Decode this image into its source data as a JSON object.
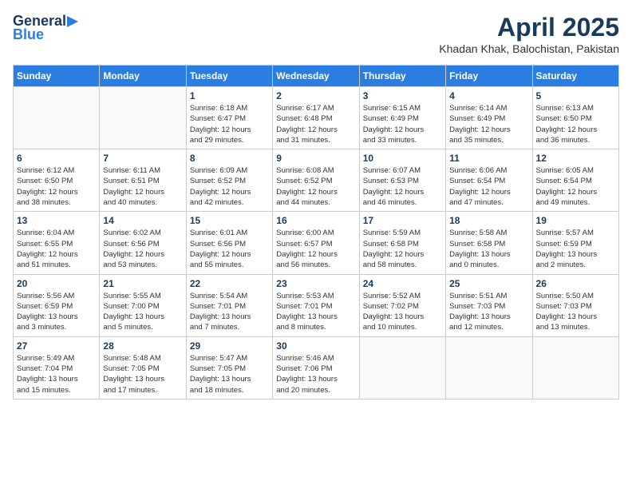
{
  "header": {
    "logo_general": "General",
    "logo_blue": "Blue",
    "title": "April 2025",
    "location": "Khadan Khak, Balochistan, Pakistan"
  },
  "weekdays": [
    "Sunday",
    "Monday",
    "Tuesday",
    "Wednesday",
    "Thursday",
    "Friday",
    "Saturday"
  ],
  "weeks": [
    [
      {
        "day": "",
        "info": ""
      },
      {
        "day": "",
        "info": ""
      },
      {
        "day": "1",
        "info": "Sunrise: 6:18 AM\nSunset: 6:47 PM\nDaylight: 12 hours\nand 29 minutes."
      },
      {
        "day": "2",
        "info": "Sunrise: 6:17 AM\nSunset: 6:48 PM\nDaylight: 12 hours\nand 31 minutes."
      },
      {
        "day": "3",
        "info": "Sunrise: 6:15 AM\nSunset: 6:49 PM\nDaylight: 12 hours\nand 33 minutes."
      },
      {
        "day": "4",
        "info": "Sunrise: 6:14 AM\nSunset: 6:49 PM\nDaylight: 12 hours\nand 35 minutes."
      },
      {
        "day": "5",
        "info": "Sunrise: 6:13 AM\nSunset: 6:50 PM\nDaylight: 12 hours\nand 36 minutes."
      }
    ],
    [
      {
        "day": "6",
        "info": "Sunrise: 6:12 AM\nSunset: 6:50 PM\nDaylight: 12 hours\nand 38 minutes."
      },
      {
        "day": "7",
        "info": "Sunrise: 6:11 AM\nSunset: 6:51 PM\nDaylight: 12 hours\nand 40 minutes."
      },
      {
        "day": "8",
        "info": "Sunrise: 6:09 AM\nSunset: 6:52 PM\nDaylight: 12 hours\nand 42 minutes."
      },
      {
        "day": "9",
        "info": "Sunrise: 6:08 AM\nSunset: 6:52 PM\nDaylight: 12 hours\nand 44 minutes."
      },
      {
        "day": "10",
        "info": "Sunrise: 6:07 AM\nSunset: 6:53 PM\nDaylight: 12 hours\nand 46 minutes."
      },
      {
        "day": "11",
        "info": "Sunrise: 6:06 AM\nSunset: 6:54 PM\nDaylight: 12 hours\nand 47 minutes."
      },
      {
        "day": "12",
        "info": "Sunrise: 6:05 AM\nSunset: 6:54 PM\nDaylight: 12 hours\nand 49 minutes."
      }
    ],
    [
      {
        "day": "13",
        "info": "Sunrise: 6:04 AM\nSunset: 6:55 PM\nDaylight: 12 hours\nand 51 minutes."
      },
      {
        "day": "14",
        "info": "Sunrise: 6:02 AM\nSunset: 6:56 PM\nDaylight: 12 hours\nand 53 minutes."
      },
      {
        "day": "15",
        "info": "Sunrise: 6:01 AM\nSunset: 6:56 PM\nDaylight: 12 hours\nand 55 minutes."
      },
      {
        "day": "16",
        "info": "Sunrise: 6:00 AM\nSunset: 6:57 PM\nDaylight: 12 hours\nand 56 minutes."
      },
      {
        "day": "17",
        "info": "Sunrise: 5:59 AM\nSunset: 6:58 PM\nDaylight: 12 hours\nand 58 minutes."
      },
      {
        "day": "18",
        "info": "Sunrise: 5:58 AM\nSunset: 6:58 PM\nDaylight: 13 hours\nand 0 minutes."
      },
      {
        "day": "19",
        "info": "Sunrise: 5:57 AM\nSunset: 6:59 PM\nDaylight: 13 hours\nand 2 minutes."
      }
    ],
    [
      {
        "day": "20",
        "info": "Sunrise: 5:56 AM\nSunset: 6:59 PM\nDaylight: 13 hours\nand 3 minutes."
      },
      {
        "day": "21",
        "info": "Sunrise: 5:55 AM\nSunset: 7:00 PM\nDaylight: 13 hours\nand 5 minutes."
      },
      {
        "day": "22",
        "info": "Sunrise: 5:54 AM\nSunset: 7:01 PM\nDaylight: 13 hours\nand 7 minutes."
      },
      {
        "day": "23",
        "info": "Sunrise: 5:53 AM\nSunset: 7:01 PM\nDaylight: 13 hours\nand 8 minutes."
      },
      {
        "day": "24",
        "info": "Sunrise: 5:52 AM\nSunset: 7:02 PM\nDaylight: 13 hours\nand 10 minutes."
      },
      {
        "day": "25",
        "info": "Sunrise: 5:51 AM\nSunset: 7:03 PM\nDaylight: 13 hours\nand 12 minutes."
      },
      {
        "day": "26",
        "info": "Sunrise: 5:50 AM\nSunset: 7:03 PM\nDaylight: 13 hours\nand 13 minutes."
      }
    ],
    [
      {
        "day": "27",
        "info": "Sunrise: 5:49 AM\nSunset: 7:04 PM\nDaylight: 13 hours\nand 15 minutes."
      },
      {
        "day": "28",
        "info": "Sunrise: 5:48 AM\nSunset: 7:05 PM\nDaylight: 13 hours\nand 17 minutes."
      },
      {
        "day": "29",
        "info": "Sunrise: 5:47 AM\nSunset: 7:05 PM\nDaylight: 13 hours\nand 18 minutes."
      },
      {
        "day": "30",
        "info": "Sunrise: 5:46 AM\nSunset: 7:06 PM\nDaylight: 13 hours\nand 20 minutes."
      },
      {
        "day": "",
        "info": ""
      },
      {
        "day": "",
        "info": ""
      },
      {
        "day": "",
        "info": ""
      }
    ]
  ]
}
